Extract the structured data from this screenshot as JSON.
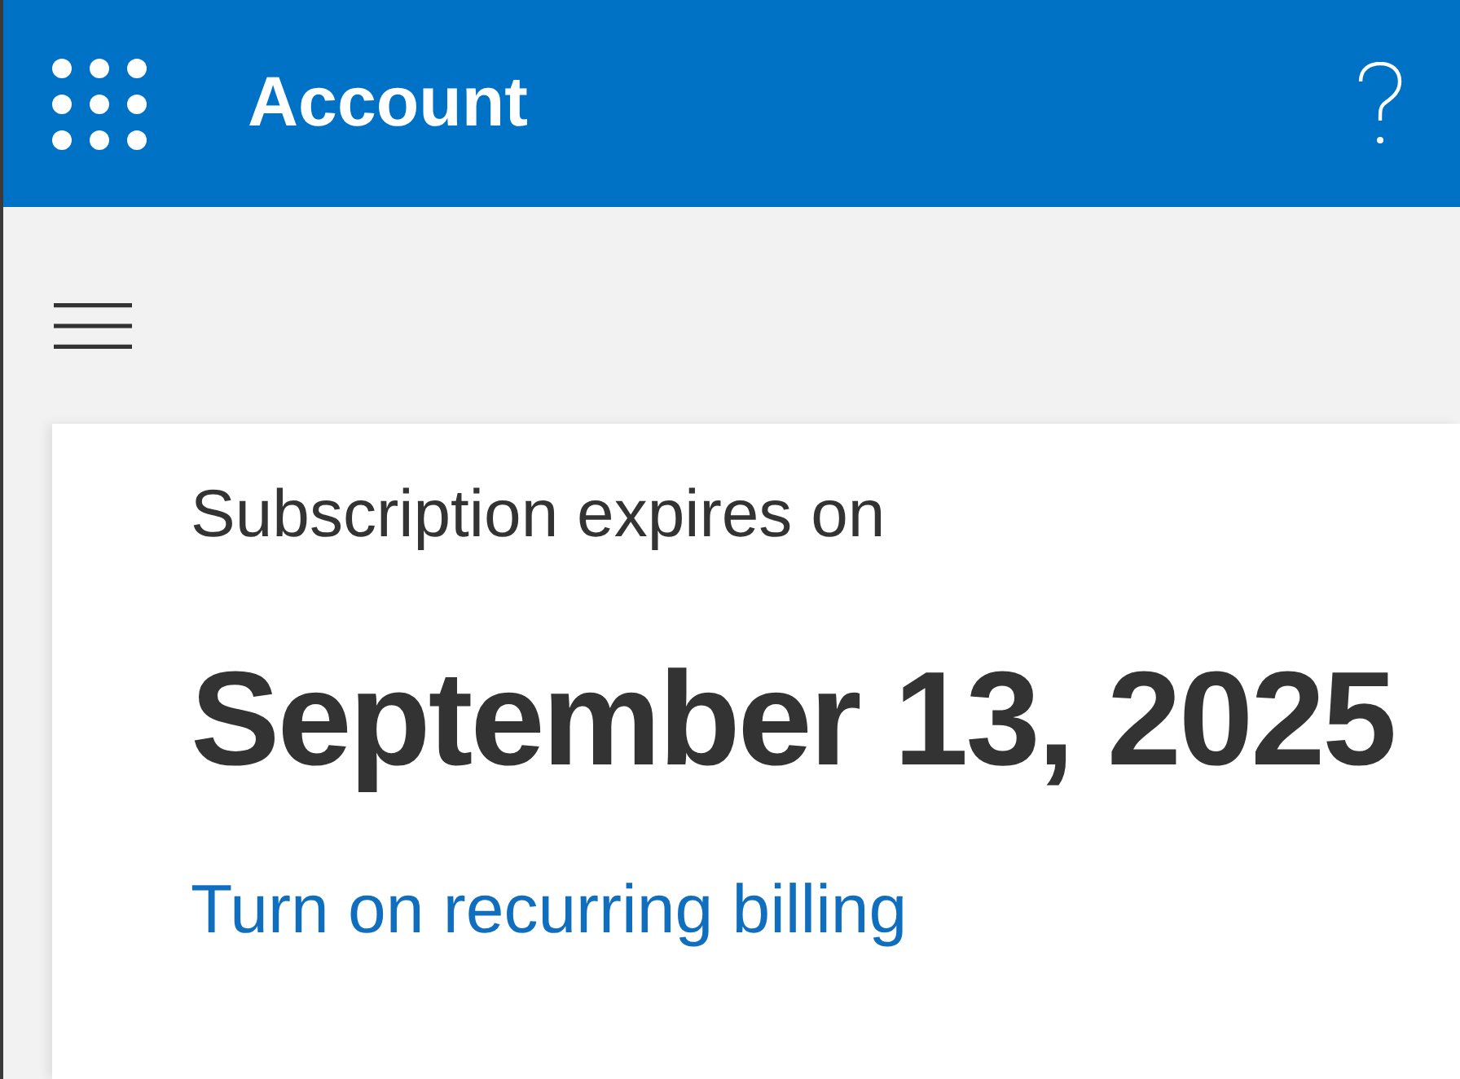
{
  "header": {
    "title": "Account"
  },
  "subscription": {
    "label": "Subscription expires on",
    "date": "September 13, 2025",
    "link": "Turn on recurring billing"
  }
}
